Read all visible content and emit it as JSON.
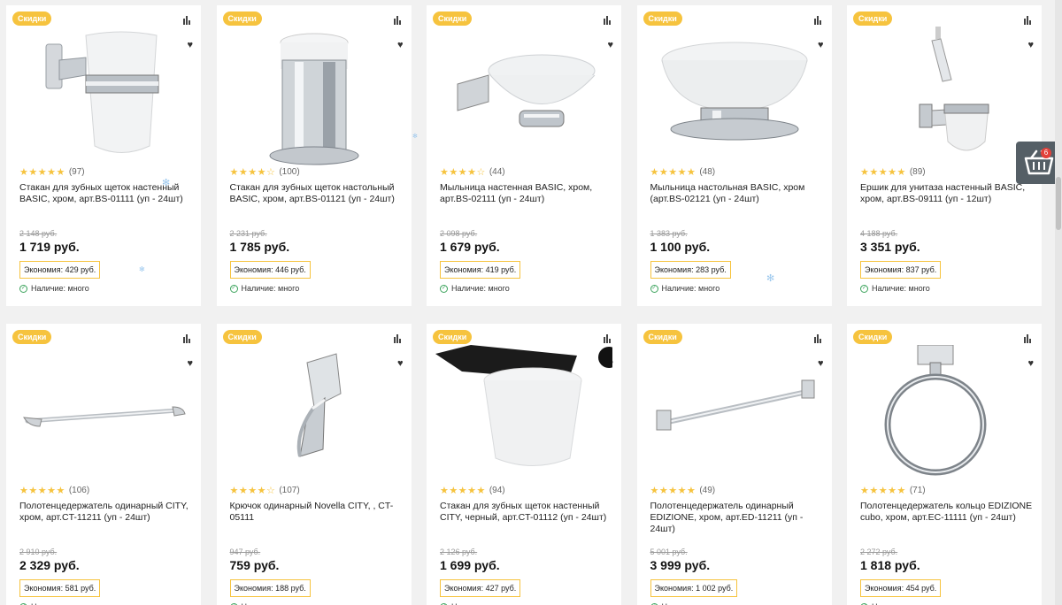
{
  "cart": {
    "count": "6",
    "icon": "basket-icon"
  },
  "products": [
    {
      "badge": "Скидки",
      "reviews": "(97)",
      "rating": 5,
      "title": "Стакан для зубных щеток настенный BASIC, хром, арт.BS-01111 (уп - 24шт)",
      "old_price": "2 148 руб.",
      "price": "1 719 руб.",
      "saving": "Экономия: 429 руб.",
      "stock": "Наличие: много",
      "image": "wall-glass-holder"
    },
    {
      "badge": "Скидки",
      "reviews": "(100)",
      "rating": 4,
      "title": "Стакан для зубных щеток настольный BASIC, хром, арт.BS-01121 (уп - 24шт)",
      "old_price": "2 231 руб.",
      "price": "1 785 руб.",
      "saving": "Экономия: 446 руб.",
      "stock": "Наличие: много",
      "image": "table-glass"
    },
    {
      "badge": "Скидки",
      "reviews": "(44)",
      "rating": 4,
      "title": "Мыльница настенная BASIC, хром, арт.BS-02111 (уп - 24шт)",
      "old_price": "2 098 руб.",
      "price": "1 679 руб.",
      "saving": "Экономия: 419 руб.",
      "stock": "Наличие: много",
      "image": "wall-soap-dish"
    },
    {
      "badge": "Скидки",
      "reviews": "(48)",
      "rating": 5,
      "title": "Мыльница настольная BASIC, хром (арт.BS-02121 (уп - 24шт)",
      "old_price": "1 383 руб.",
      "price": "1 100 руб.",
      "saving": "Экономия: 283 руб.",
      "stock": "Наличие: много",
      "image": "table-soap-dish"
    },
    {
      "badge": "Скидки",
      "reviews": "(89)",
      "rating": 5,
      "title": "Ершик для унитаза настенный BASIC, хром, арт.BS-09111 (уп - 12шт)",
      "old_price": "4 188 руб.",
      "price": "3 351 руб.",
      "saving": "Экономия: 837 руб.",
      "stock": "Наличие: много",
      "image": "toilet-brush"
    },
    {
      "badge": "Скидки",
      "reviews": "(106)",
      "rating": 5,
      "title": "Полотенцедержатель одинарный CITY, хром, арт.CT-11211 (уп - 24шт)",
      "old_price": "2 910 руб.",
      "price": "2 329 руб.",
      "saving": "Экономия: 581 руб.",
      "stock": "Наличие: много",
      "image": "towel-bar-city"
    },
    {
      "badge": "Скидки",
      "reviews": "(107)",
      "rating": 4,
      "title": "Крючок одинарный Novella CITY, , CT-05111",
      "old_price": "947 руб.",
      "price": "759 руб.",
      "saving": "Экономия: 188 руб.",
      "stock": "Наличие: много",
      "image": "hook"
    },
    {
      "badge": "Скидки",
      "reviews": "(94)",
      "rating": 5,
      "title": "Стакан для зубных щеток настенный CITY, черный, арт.CT-01112 (уп - 24шт)",
      "old_price": "2 126 руб.",
      "price": "1 699 руб.",
      "saving": "Экономия: 427 руб.",
      "stock": "Наличие: много",
      "image": "black-glass-holder"
    },
    {
      "badge": "Скидки",
      "reviews": "(49)",
      "rating": 5,
      "title": "Полотенцедержатель одинарный EDIZIONE, хром, арт.ED-11211 (уп - 24шт)",
      "old_price": "5 001 руб.",
      "price": "3 999 руб.",
      "saving": "Экономия: 1 002 руб.",
      "stock": "Наличие: много",
      "image": "towel-bar-edizione"
    },
    {
      "badge": "Скидки",
      "reviews": "(71)",
      "rating": 5,
      "title": "Полотенцедержатель кольцо EDIZIONE cubo, хром, арт.EC-11111 (уп - 24шт)",
      "old_price": "2 272 руб.",
      "price": "1 818 руб.",
      "saving": "Экономия: 454 руб.",
      "stock": "Наличие: мало",
      "image": "towel-ring"
    }
  ]
}
